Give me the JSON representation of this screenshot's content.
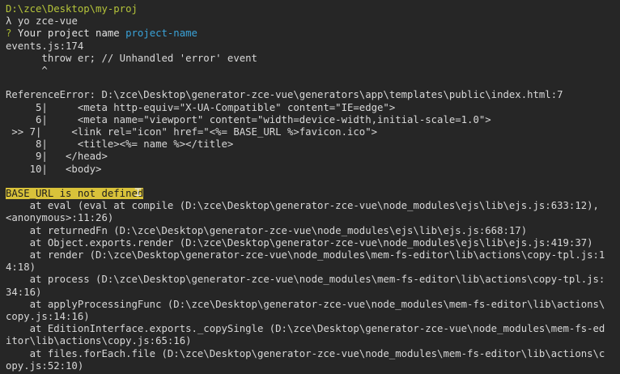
{
  "terminal": {
    "cwd": "D:\\zce\\Desktop\\my-proj",
    "prompt_symbol": "λ",
    "command": "yo zce-vue",
    "question_mark": "?",
    "question": "Your project name",
    "answer": "project-name",
    "lines": [
      "events.js:174",
      "      throw er; // Unhandled 'error' event",
      "      ^",
      "",
      "ReferenceError: D:\\zce\\Desktop\\generator-zce-vue\\generators\\app\\templates\\public\\index.html:7",
      "     5|     <meta http-equiv=\"X-UA-Compatible\" content=\"IE=edge\">",
      "     6|     <meta name=\"viewport\" content=\"width=device-width,initial-scale=1.0\">",
      " >> 7|     <link rel=\"icon\" href=\"<%= BASE_URL %>favicon.ico\">",
      "     8|     <title><%= name %></title>",
      "     9|   </head>",
      "    10|   <body>",
      ""
    ],
    "error_highlight": "BASE_URL is not defined",
    "stack_lines": [
      "    at eval (eval at compile (D:\\zce\\Desktop\\generator-zce-vue\\node_modules\\ejs\\lib\\ejs.js:633:12),",
      "<anonymous>:11:26)",
      "    at returnedFn (D:\\zce\\Desktop\\generator-zce-vue\\node_modules\\ejs\\lib\\ejs.js:668:17)",
      "    at Object.exports.render (D:\\zce\\Desktop\\generator-zce-vue\\node_modules\\ejs\\lib\\ejs.js:419:37)",
      "    at render (D:\\zce\\Desktop\\generator-zce-vue\\node_modules\\mem-fs-editor\\lib\\actions\\copy-tpl.js:1",
      "4:18)",
      "    at process (D:\\zce\\Desktop\\generator-zce-vue\\node_modules\\mem-fs-editor\\lib\\actions\\copy-tpl.js:",
      "34:16)",
      "    at applyProcessingFunc (D:\\zce\\Desktop\\generator-zce-vue\\node_modules\\mem-fs-editor\\lib\\actions\\",
      "copy.js:14:16)",
      "    at EditionInterface.exports._copySingle (D:\\zce\\Desktop\\generator-zce-vue\\node_modules\\mem-fs-ed",
      "itor\\lib\\actions\\copy.js:65:16)",
      "    at files.forEach.file (D:\\zce\\Desktop\\generator-zce-vue\\node_modules\\mem-fs-editor\\lib\\actions\\c",
      "opy.js:52:10)"
    ]
  }
}
